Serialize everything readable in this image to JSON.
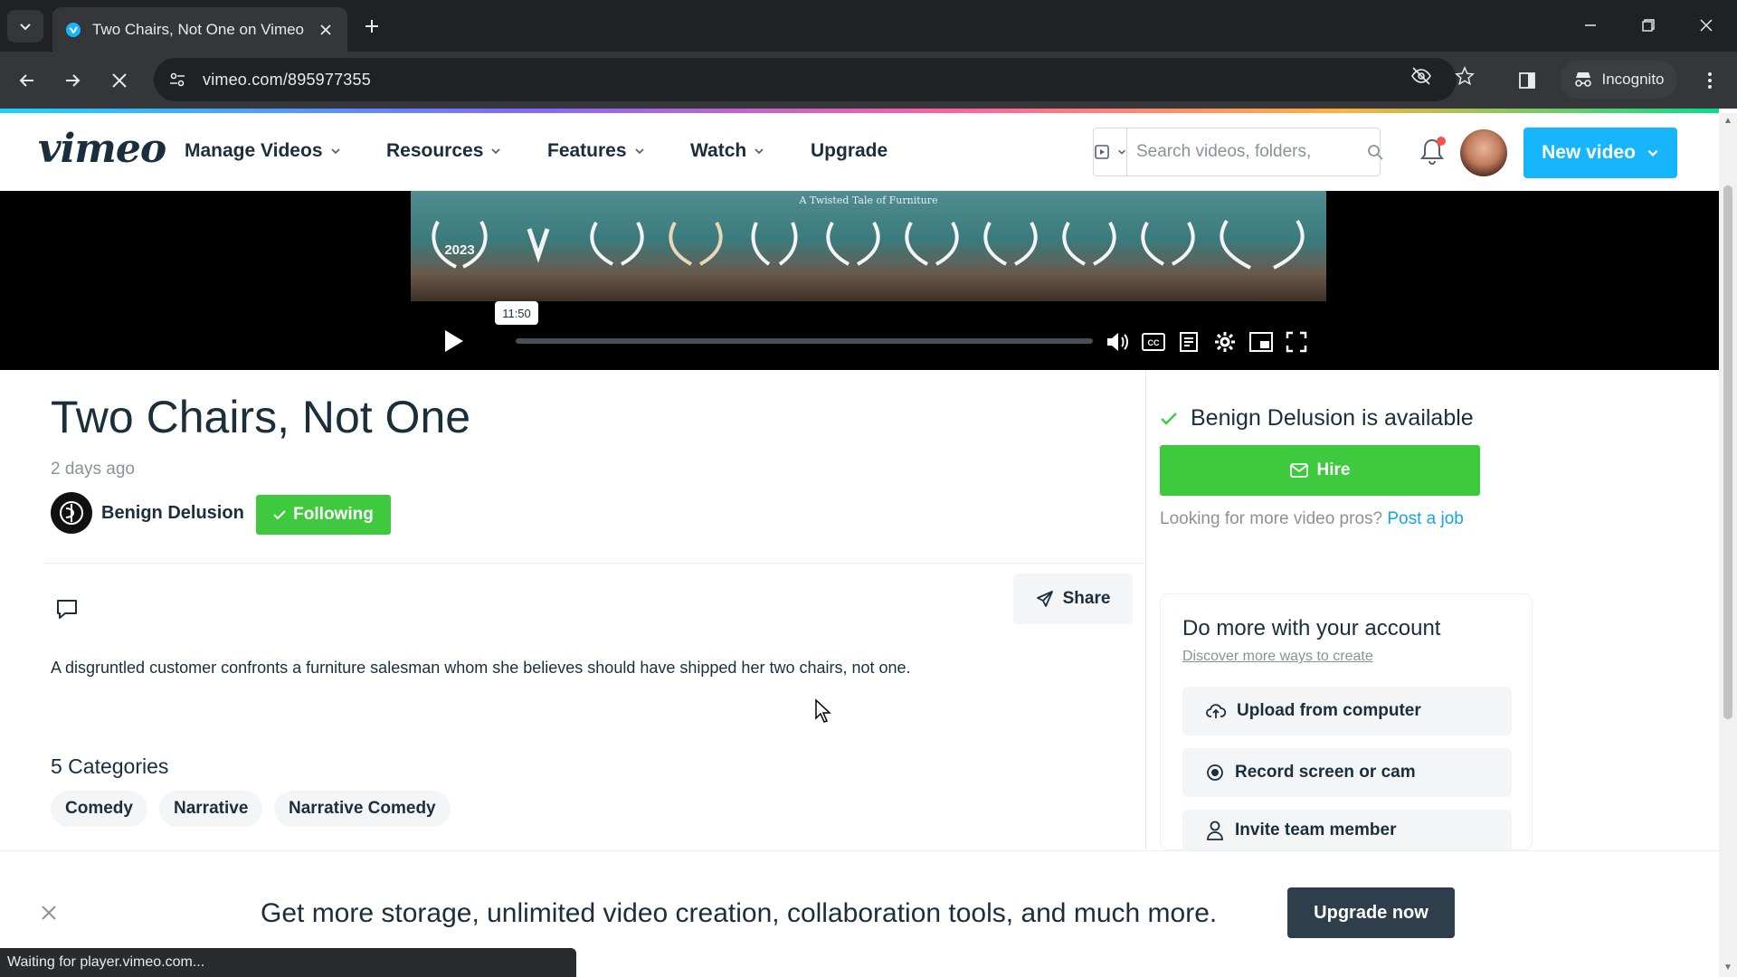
{
  "browser": {
    "tab_title": "Two Chairs, Not One on Vimeo",
    "url": "vimeo.com/895977355",
    "incognito_label": "Incognito",
    "status_text": "Waiting for player.vimeo.com..."
  },
  "header": {
    "logo": "vimeo",
    "nav": [
      "Manage Videos",
      "Resources",
      "Features",
      "Watch",
      "Upgrade"
    ],
    "search_placeholder": "Search videos, folders,",
    "new_video_label": "New video"
  },
  "player": {
    "poster_tagline": "A Twisted Tale of Furniture",
    "laurel_year": "2023",
    "tooltip_time": "11:50",
    "progress_fraction": 0.0
  },
  "video": {
    "title": "Two Chairs, Not One",
    "posted": "2 days ago",
    "creator": "Benign Delusion",
    "following_label": "Following",
    "share_label": "Share",
    "description": "A disgruntled customer confronts a furniture salesman whom she believes should have shipped her two chairs, not one.",
    "categories_title": "5 Categories",
    "categories": [
      "Comedy",
      "Narrative",
      "Narrative Comedy"
    ]
  },
  "sidebar": {
    "available_text": "Benign Delusion is available",
    "hire_label": "Hire",
    "looking_text": "Looking for more video pros?",
    "post_job_link": "Post a job",
    "domore_title": "Do more with your account",
    "domore_sub": "Discover more ways to create",
    "actions": [
      "Upload from computer",
      "Record screen or cam",
      "Invite team member"
    ]
  },
  "banner": {
    "text": "Get more storage, unlimited video creation, collaboration tools, and much more.",
    "button_label": "Upgrade now"
  },
  "colors": {
    "brand_blue": "#17b5fb",
    "green": "#3ec93e",
    "dark": "#1a2e3b"
  }
}
